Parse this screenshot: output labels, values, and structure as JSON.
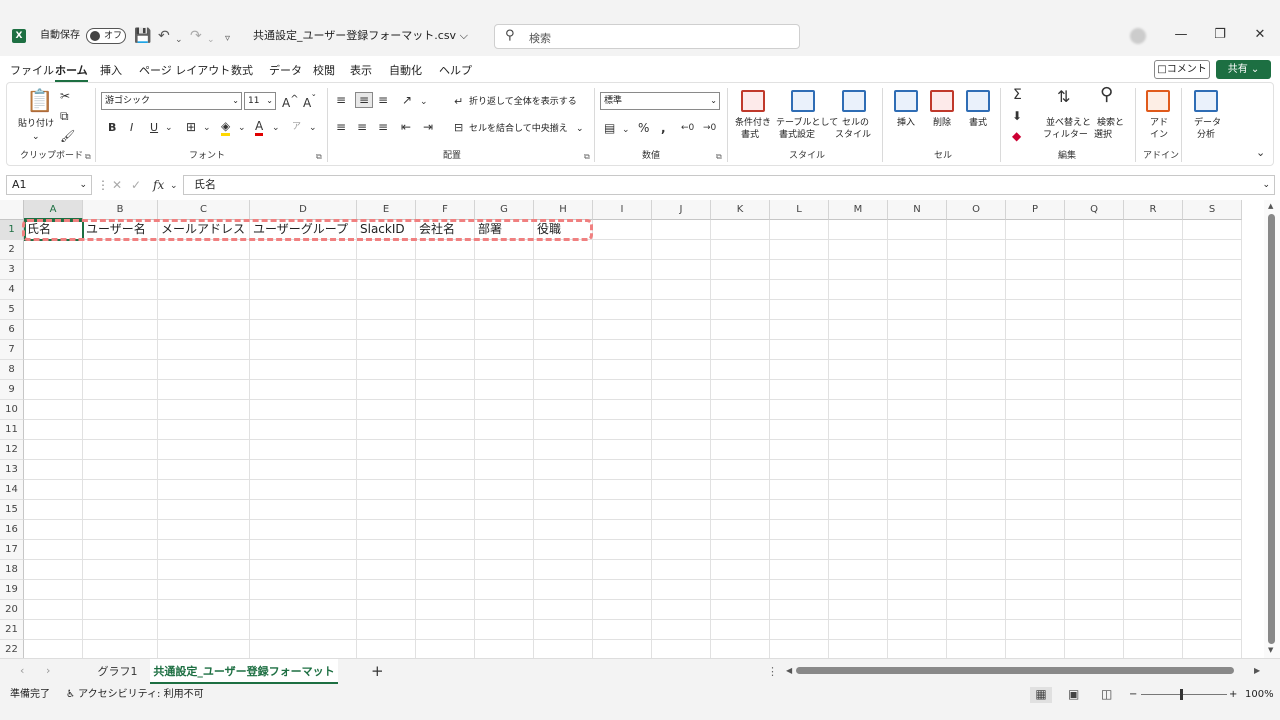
{
  "titlebar": {
    "app_icon": "X",
    "autosave_label": "自動保存",
    "autosave_state": "オフ",
    "filename": "共通設定_ユーザー登録フォーマット.csv",
    "filename_chevron": "⌵",
    "search_placeholder": "検索"
  },
  "menu": {
    "items": [
      "ファイル",
      "ホーム",
      "挿入",
      "ページ レイアウト",
      "数式",
      "データ",
      "校閲",
      "表示",
      "自動化",
      "ヘルプ"
    ],
    "active": "ホーム",
    "comment_label": "コメント",
    "share_label": "共有"
  },
  "ribbon": {
    "clipboard": {
      "paste_label": "貼り付け",
      "group_label": "クリップボード"
    },
    "font": {
      "font_name": "游ゴシック",
      "font_size": "11",
      "bold": "B",
      "italic": "I",
      "underline": "U",
      "group_label": "フォント"
    },
    "alignment": {
      "wrap_label": "折り返して全体を表示する",
      "merge_label": "セルを結合して中央揃え",
      "group_label": "配置"
    },
    "number": {
      "format": "標準",
      "group_label": "数値"
    },
    "styles": {
      "cond_label_1": "条件付き",
      "cond_label_2": "書式",
      "table_label_1": "テーブルとして",
      "table_label_2": "書式設定",
      "cell_label_1": "セルの",
      "cell_label_2": "スタイル",
      "group_label": "スタイル"
    },
    "cells": {
      "insert_label": "挿入",
      "delete_label": "削除",
      "format_label": "書式",
      "group_label": "セル"
    },
    "editing": {
      "sort_label_1": "並べ替えと",
      "sort_label_2": "フィルター",
      "find_label_1": "検索と",
      "find_label_2": "選択",
      "group_label": "編集"
    },
    "addins": {
      "label_1": "アド",
      "label_2": "イン",
      "group_label": "アドイン"
    },
    "analysis": {
      "label_1": "データ",
      "label_2": "分析"
    }
  },
  "formula_bar": {
    "name_box": "A1",
    "fx": "fx",
    "content": "氏名"
  },
  "grid": {
    "columns": [
      "A",
      "B",
      "C",
      "D",
      "E",
      "F",
      "G",
      "H",
      "I",
      "J",
      "K",
      "L",
      "M",
      "N",
      "O",
      "P",
      "Q",
      "R",
      "S"
    ],
    "rows": [
      "1",
      "2",
      "3",
      "4",
      "5",
      "6",
      "7",
      "8",
      "9",
      "10",
      "11",
      "12",
      "13",
      "14",
      "15",
      "16",
      "17",
      "18",
      "19",
      "20",
      "21",
      "22"
    ],
    "row1": [
      "氏名",
      "ユーザー名",
      "メールアドレス",
      "ユーザーグループ",
      "SlackID",
      "会社名",
      "部署",
      "役職"
    ]
  },
  "sheets": {
    "tabs": [
      "グラフ1",
      "共通設定_ユーザー登録フォーマット"
    ],
    "active": "共通設定_ユーザー登録フォーマット",
    "add": "+"
  },
  "status": {
    "ready": "準備完了",
    "accessibility": "アクセシビリティ: 利用不可",
    "zoom": "100%"
  },
  "colors": {
    "accent": "#1d6f42",
    "highlight": "#f08080"
  }
}
